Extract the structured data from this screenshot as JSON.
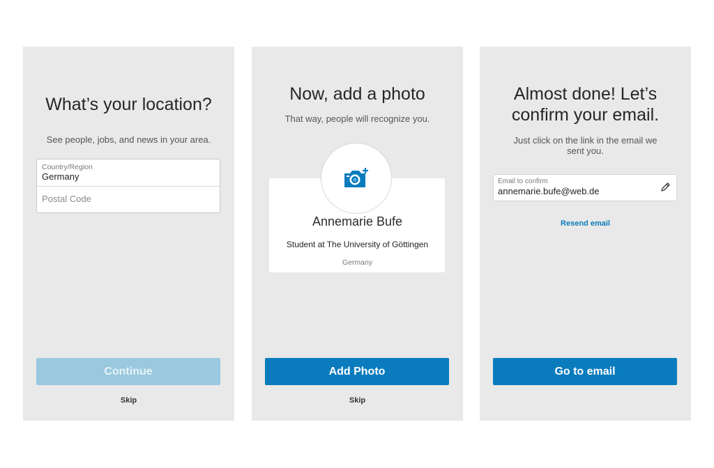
{
  "location_screen": {
    "title": "What’s your location?",
    "subtitle": "See people, jobs, and news in your area.",
    "country_label": "Country/Region",
    "country_value": "Germany",
    "postal_placeholder": "Postal Code",
    "continue_label": "Continue",
    "skip_label": "Skip"
  },
  "photo_screen": {
    "title": "Now, add a photo",
    "subtitle": "That way, people will recognize you.",
    "profile": {
      "name": "Annemarie Bufe",
      "headline": "Student at The University of Göttingen",
      "location": "Germany"
    },
    "add_photo_label": "Add Photo",
    "skip_label": "Skip",
    "icon": "camera-plus-icon"
  },
  "email_screen": {
    "title_line1": "Almost done! Let’s",
    "title_line2": "confirm your email.",
    "subtitle_line1": "Just click on the link in the email we",
    "subtitle_line2": "sent you.",
    "email_label": "Email to confirm",
    "email_value": "annemarie.bufe@web.de",
    "resend_label": "Resend email",
    "go_label": "Go to email",
    "icon": "pencil-icon"
  },
  "colors": {
    "screen_bg": "#e9e9e9",
    "primary": "#0a7cbd",
    "primary_disabled": "#9ac8df"
  }
}
